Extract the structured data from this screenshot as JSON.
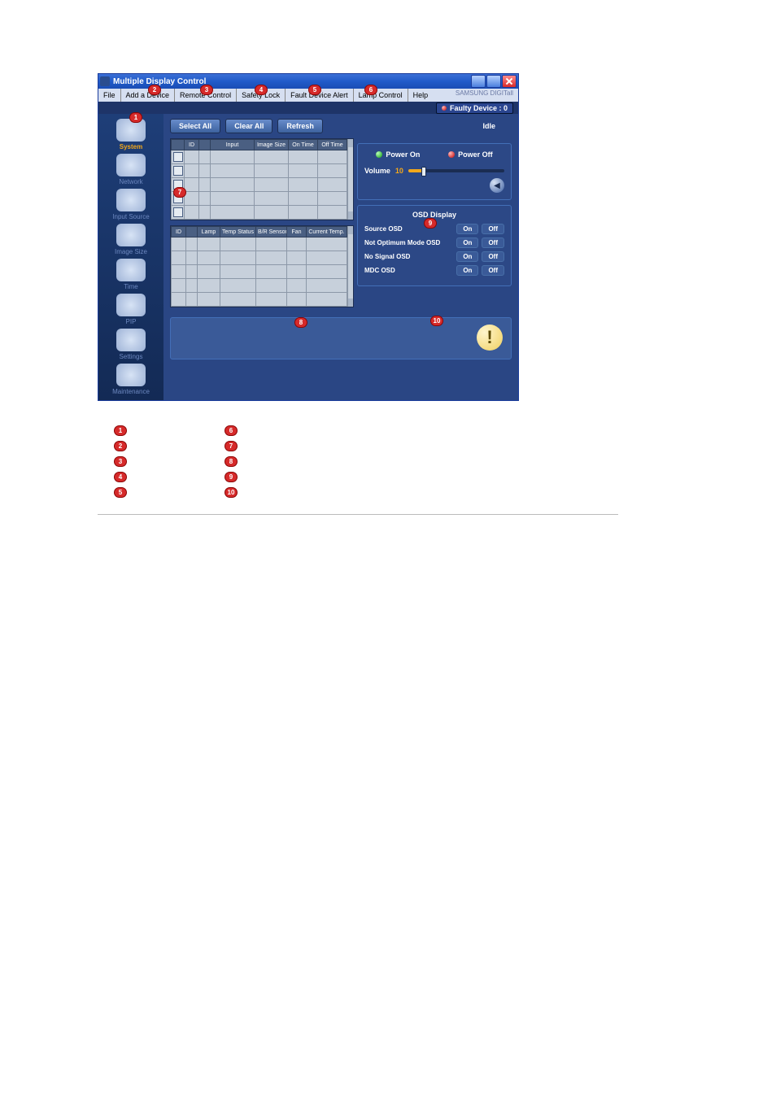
{
  "window": {
    "title": "Multiple Display Control",
    "brand": "SAMSUNG DIGITall"
  },
  "menu": {
    "file": "File",
    "add_device": "Add a Device",
    "remote_control": "Remote Control",
    "safety_lock": "Safety Lock",
    "fault_device_alert": "Fault Device Alert",
    "lamp_control": "Lamp Control",
    "help": "Help"
  },
  "faulty": {
    "label": "Faulty Device : 0"
  },
  "sidebar": {
    "items": [
      {
        "label": "System"
      },
      {
        "label": "Network"
      },
      {
        "label": "Input Source"
      },
      {
        "label": "Image Size"
      },
      {
        "label": "Time"
      },
      {
        "label": "PIP"
      },
      {
        "label": "Settings"
      },
      {
        "label": "Maintenance"
      }
    ]
  },
  "tools": {
    "select_all": "Select All",
    "clear_all": "Clear All",
    "refresh": "Refresh",
    "idle": "Idle"
  },
  "grid1": {
    "headers": [
      "",
      "ID",
      "",
      "Input",
      "Image Size",
      "On Time",
      "Off Time"
    ]
  },
  "grid2": {
    "headers": [
      "ID",
      "",
      "Lamp",
      "Temp Status",
      "B/R Sensor",
      "Fan",
      "Current Temp."
    ]
  },
  "power": {
    "on": "Power On",
    "off": "Power Off"
  },
  "volume": {
    "label": "Volume",
    "value": "10"
  },
  "osd": {
    "title": "OSD Display",
    "on": "On",
    "off": "Off",
    "rows": [
      {
        "label": "Source OSD"
      },
      {
        "label": "Not Optimum Mode OSD"
      },
      {
        "label": "No Signal OSD"
      },
      {
        "label": "MDC OSD"
      }
    ]
  },
  "legend": {
    "left": [
      "1",
      "2",
      "3",
      "4",
      "5"
    ],
    "right": [
      "6",
      "7",
      "8",
      "9",
      "10"
    ]
  }
}
